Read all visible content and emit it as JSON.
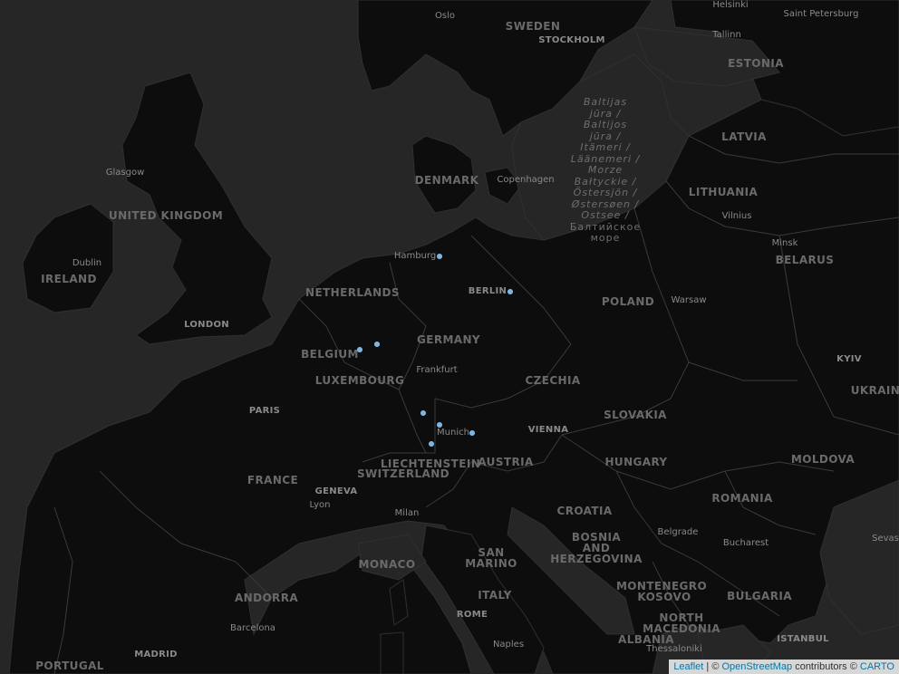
{
  "map": {
    "style": "dark",
    "colors": {
      "sea": "#262627",
      "land": "#0d0d0d",
      "border": "#3a3a3a",
      "marker": "#74b4e8"
    },
    "countries": [
      {
        "name": "SWEDEN"
      },
      {
        "name": "ESTONIA"
      },
      {
        "name": "LATVIA"
      },
      {
        "name": "LITHUANIA"
      },
      {
        "name": "DENMARK"
      },
      {
        "name": "UNITED KINGDOM"
      },
      {
        "name": "IRELAND"
      },
      {
        "name": "NETHERLANDS"
      },
      {
        "name": "BELARUS"
      },
      {
        "name": "POLAND"
      },
      {
        "name": "GERMANY"
      },
      {
        "name": "BELGIUM"
      },
      {
        "name": "LUXEMBOURG"
      },
      {
        "name": "CZECHIA"
      },
      {
        "name": "SLOVAKIA"
      },
      {
        "name": "UKRAIN"
      },
      {
        "name": "FRANCE"
      },
      {
        "name": "AUSTRIA"
      },
      {
        "name": "HUNGARY"
      },
      {
        "name": "LIECHTENSTEIN"
      },
      {
        "name": "SWITZERLAND"
      },
      {
        "name": "MOLDOVA"
      },
      {
        "name": "ROMANIA"
      },
      {
        "name": "CROATIA"
      },
      {
        "name": "SAN"
      },
      {
        "name": "MARINO"
      },
      {
        "name": "BOSNIA"
      },
      {
        "name": "AND"
      },
      {
        "name": "HERZEGOVINA"
      },
      {
        "name": "MONACO"
      },
      {
        "name": "ANDORRA"
      },
      {
        "name": "ITALY"
      },
      {
        "name": "MONTENEGRO"
      },
      {
        "name": "KOSOVO"
      },
      {
        "name": "BULGARIA"
      },
      {
        "name": "NORTH"
      },
      {
        "name": "MACEDONIA"
      },
      {
        "name": "ALBANIA"
      },
      {
        "name": "PORTUGAL"
      }
    ],
    "cities": [
      {
        "name": "Oslo"
      },
      {
        "name": "Helsinki"
      },
      {
        "name": "Saint Petersburg"
      },
      {
        "name": "STOCKHOLM"
      },
      {
        "name": "Tallinn"
      },
      {
        "name": "Glasgow"
      },
      {
        "name": "Copenhagen"
      },
      {
        "name": "Vilnius"
      },
      {
        "name": "Dublin"
      },
      {
        "name": "Hamburg"
      },
      {
        "name": "Minsk"
      },
      {
        "name": "BERLIN"
      },
      {
        "name": "LONDON"
      },
      {
        "name": "Warsaw"
      },
      {
        "name": "Frankfurt"
      },
      {
        "name": "KYIV"
      },
      {
        "name": "PARIS"
      },
      {
        "name": "VIENNA"
      },
      {
        "name": "Munich"
      },
      {
        "name": "GENEVA"
      },
      {
        "name": "Lyon"
      },
      {
        "name": "Milan"
      },
      {
        "name": "Belgrade"
      },
      {
        "name": "Bucharest"
      },
      {
        "name": "Sevas"
      },
      {
        "name": "ROME"
      },
      {
        "name": "Barcelona"
      },
      {
        "name": "Naples"
      },
      {
        "name": "MADRID"
      },
      {
        "name": "ISTANBUL"
      },
      {
        "name": "Thessaloniki"
      }
    ],
    "sea_label": [
      "Baltijas",
      "jūra /",
      "Baltijos",
      "jūra /",
      "Itämeri /",
      "Läänemeri /",
      "Morze",
      "Bałtyckie /",
      "Östersjön /",
      "Østersøen /",
      "Ostsee /",
      "Балтийское",
      "море"
    ],
    "markers": [
      {
        "lat": 53.55,
        "lon": 9.99
      },
      {
        "lat": 52.52,
        "lon": 13.4
      },
      {
        "lat": 50.94,
        "lon": 6.96
      },
      {
        "lat": 50.78,
        "lon": 6.08
      },
      {
        "lat": 48.78,
        "lon": 9.18
      },
      {
        "lat": 48.4,
        "lon": 9.99
      },
      {
        "lat": 48.14,
        "lon": 11.58
      },
      {
        "lat": 47.66,
        "lon": 9.48
      }
    ]
  },
  "attribution": {
    "leaflet": "Leaflet",
    "sep1": " | © ",
    "osm": "OpenStreetMap",
    "mid": " contributors © ",
    "carto": "CARTO"
  }
}
